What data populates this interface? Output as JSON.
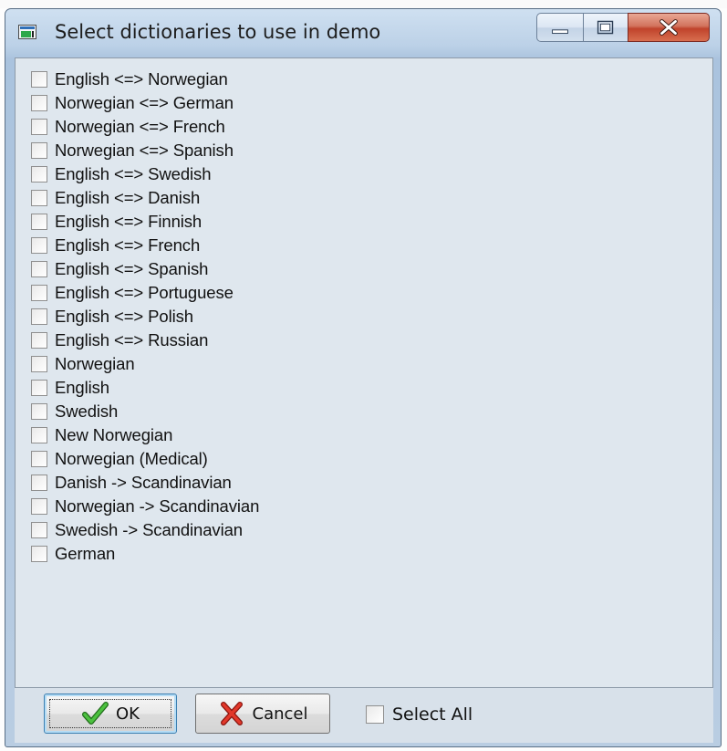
{
  "window": {
    "title": "Select dictionaries to use in demo",
    "controls": {
      "minimize_icon": "minimize-icon",
      "maximize_icon": "maximize-icon",
      "close_icon": "close-icon"
    }
  },
  "dictionaries": [
    {
      "label": "English <=> Norwegian",
      "checked": false
    },
    {
      "label": "Norwegian <=> German",
      "checked": false
    },
    {
      "label": "Norwegian <=> French",
      "checked": false
    },
    {
      "label": "Norwegian <=> Spanish",
      "checked": false
    },
    {
      "label": "English <=> Swedish",
      "checked": false
    },
    {
      "label": "English <=> Danish",
      "checked": false
    },
    {
      "label": "English <=> Finnish",
      "checked": false
    },
    {
      "label": "English <=> French",
      "checked": false
    },
    {
      "label": "English <=> Spanish",
      "checked": false
    },
    {
      "label": "English <=> Portuguese",
      "checked": false
    },
    {
      "label": "English <=> Polish",
      "checked": false
    },
    {
      "label": "English <=> Russian",
      "checked": false
    },
    {
      "label": "Norwegian",
      "checked": false
    },
    {
      "label": "English",
      "checked": false
    },
    {
      "label": "Swedish",
      "checked": false
    },
    {
      "label": "New Norwegian",
      "checked": false
    },
    {
      "label": "Norwegian (Medical)",
      "checked": false
    },
    {
      "label": "Danish -> Scandinavian",
      "checked": false
    },
    {
      "label": "Norwegian -> Scandinavian",
      "checked": false
    },
    {
      "label": "Swedish -> Scandinavian",
      "checked": false
    },
    {
      "label": "German",
      "checked": false
    }
  ],
  "footer": {
    "ok_label": "OK",
    "cancel_label": "Cancel",
    "select_all_label": "Select All",
    "select_all_checked": false
  },
  "colors": {
    "ok_check": "#3aa832",
    "cancel_x": "#d0281c",
    "close_button": "#c7432c"
  }
}
